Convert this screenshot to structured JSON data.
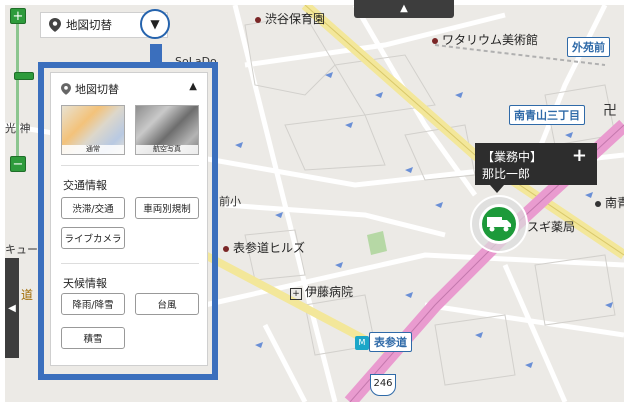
{
  "map_labels": {
    "shibuya_hoikuen": "渋谷保育園",
    "watarium": "ワタリウム美術館",
    "omotesando_hills": "表参道ヒルズ",
    "ito_hospital": "伊藤病院",
    "suginami_yakkyoku": "スギ薬局",
    "minami_ao_partial": "南青",
    "solado_partial": "SoLaDo",
    "ebisu_partial": "前小",
    "kyu_partial": "キュー",
    "michi_partial": "道",
    "ko_jin_partial": "光 神"
  },
  "stations": {
    "gaienmae": "外苑前",
    "minami_aoyama_3": "南青山三丁目",
    "omotesando": "表参道"
  },
  "route_shield": "246",
  "map_switch": {
    "label": "地図切替"
  },
  "layer_panel": {
    "title": "地図切替",
    "map_types": {
      "normal": "通常",
      "aerial": "航空写真"
    },
    "traffic": {
      "heading": "交通情報",
      "congestion": "渋滞/交通",
      "vehicle_restriction": "車両別規制",
      "live_camera": "ライブカメラ"
    },
    "weather": {
      "heading": "天候情報",
      "rain_snow": "降雨/降雪",
      "typhoon": "台風",
      "snow": "積雪"
    }
  },
  "vehicle_popup": {
    "status": "【業務中】",
    "driver": "那比一郎"
  },
  "colors": {
    "accent_blue": "#3b6fbd",
    "vehicle_green": "#1d9a3a",
    "highway_pink": "#e99bcf"
  }
}
